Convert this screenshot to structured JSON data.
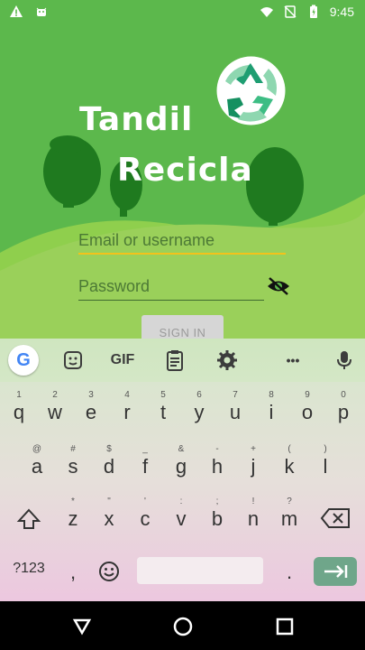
{
  "status_bar": {
    "time": "9:45",
    "left_icons": [
      "warning-icon",
      "android-icon"
    ],
    "right_icons": [
      "wifi-icon",
      "no-sim-icon",
      "battery-icon"
    ]
  },
  "app": {
    "title_line1": "Tandil",
    "title_line2": "Recicla",
    "email_placeholder": "Email or username",
    "password_placeholder": "Password",
    "sign_in_label": "SIGN IN",
    "colors": {
      "background": "#5cb84c",
      "email_underline": "#f3c21b",
      "accent_dark": "#1f7a1f"
    }
  },
  "keyboard": {
    "toolbar": {
      "g": "G",
      "gif": "GIF",
      "more": "•••"
    },
    "row1": [
      {
        "k": "q",
        "h": "1"
      },
      {
        "k": "w",
        "h": "2"
      },
      {
        "k": "e",
        "h": "3"
      },
      {
        "k": "r",
        "h": "4"
      },
      {
        "k": "t",
        "h": "5"
      },
      {
        "k": "y",
        "h": "6"
      },
      {
        "k": "u",
        "h": "7"
      },
      {
        "k": "i",
        "h": "8"
      },
      {
        "k": "o",
        "h": "9"
      },
      {
        "k": "p",
        "h": "0"
      }
    ],
    "row2": [
      {
        "k": "a",
        "h": "@"
      },
      {
        "k": "s",
        "h": "#"
      },
      {
        "k": "d",
        "h": "$"
      },
      {
        "k": "f",
        "h": "_"
      },
      {
        "k": "g",
        "h": "&"
      },
      {
        "k": "h",
        "h": "-"
      },
      {
        "k": "j",
        "h": "+"
      },
      {
        "k": "k",
        "h": "("
      },
      {
        "k": "l",
        "h": ")"
      }
    ],
    "row3": [
      {
        "k": "z",
        "h": "*"
      },
      {
        "k": "x",
        "h": "\""
      },
      {
        "k": "c",
        "h": "'"
      },
      {
        "k": "v",
        "h": ":"
      },
      {
        "k": "b",
        "h": ";"
      },
      {
        "k": "n",
        "h": "!"
      },
      {
        "k": "m",
        "h": "?"
      }
    ],
    "sym_label": "?123",
    "comma": ",",
    "period": "."
  }
}
